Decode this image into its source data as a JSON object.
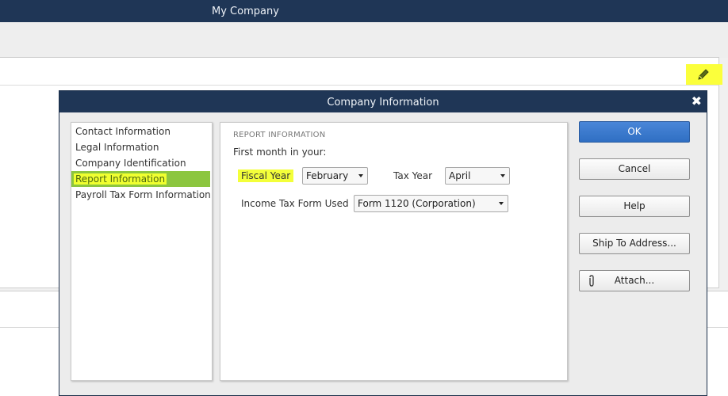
{
  "app": {
    "title": "My Company"
  },
  "dialog": {
    "title": "Company Information",
    "close_glyph": "✖",
    "nav": [
      {
        "label": "Contact Information"
      },
      {
        "label": "Legal Information"
      },
      {
        "label": "Company Identification"
      },
      {
        "label": "Report Information",
        "selected": true
      },
      {
        "label": "Payroll Tax Form Information"
      }
    ],
    "section": {
      "heading": "REPORT INFORMATION",
      "first_month_label": "First month in your:",
      "fiscal_year": {
        "label": "Fiscal Year",
        "value": "February"
      },
      "tax_year": {
        "label": "Tax Year",
        "value": "April"
      },
      "income_tax_form": {
        "label": "Income Tax Form Used",
        "value": "Form 1120 (Corporation)"
      }
    },
    "buttons": {
      "ok": "OK",
      "cancel": "Cancel",
      "help": "Help",
      "ship_to": "Ship To Address...",
      "attach": "Attach..."
    }
  },
  "colors": {
    "title_bar": "#1f3656",
    "nav_selected": "#8cc63f",
    "highlight": "#f3ff3a",
    "ok_button": "#3a7ace"
  },
  "icons": {
    "edit": "pencil-icon",
    "attach": "paperclip-icon",
    "close": "close-icon",
    "dropdown": "chevron-down-icon"
  }
}
